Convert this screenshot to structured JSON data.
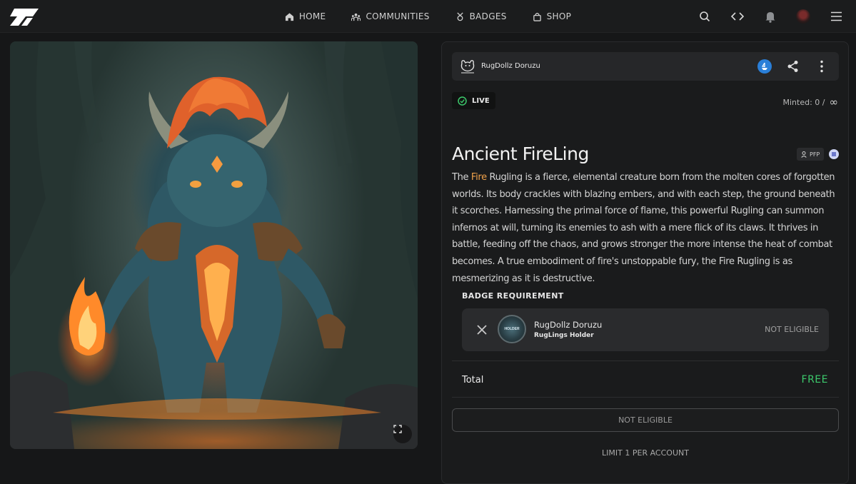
{
  "nav": {
    "logo_icon": "brand-logo-icon",
    "items": [
      {
        "label": "HOME",
        "icon": "home-icon"
      },
      {
        "label": "COMMUNITIES",
        "icon": "communities-icon"
      },
      {
        "label": "BADGES",
        "icon": "badge-icon"
      },
      {
        "label": "SHOP",
        "icon": "shop-bag-icon"
      }
    ],
    "right_icons": [
      "search-icon",
      "code-icon",
      "bell-icon",
      "avatar",
      "menu-icon"
    ]
  },
  "artwork": {
    "alt_icon": "artwork-image",
    "expand_icon": "expand-icon"
  },
  "collection": {
    "name": "RugDollz Doruzu",
    "chain_icon": "chain-icon",
    "share_icon": "share-icon",
    "more_icon": "more-vertical-icon"
  },
  "status": {
    "live_label": "LIVE",
    "minted_label": "Minted: 0 /",
    "minted_max_symbol": "∞"
  },
  "item": {
    "title": "Ancient FireLing",
    "tag": "PFP",
    "description_pre": "The ",
    "description_highlight": "Fire",
    "description_post": " Rugling is a fierce, elemental creature born from the molten cores of forgotten worlds. Its body crackles with blazing embers, and with each step, the ground beneath it scorches. Harnessing the primal force of flame, this powerful Rugling can summon infernos at will, turning its enemies to ash with a mere flick of its claws. It thrives in battle, feeding off the chaos, and grows stronger the more intense the heat of combat becomes. A true embodiment of fire's unstoppable fury, the Fire Rugling is as mesmerizing as it is destructive."
  },
  "requirement": {
    "label": "BADGE REQUIREMENT",
    "badge_name": "RugDollz Doruzu",
    "badge_sub": "RugLings Holder",
    "badge_text": "HOLDER",
    "status": "NOT ELIGIBLE"
  },
  "total": {
    "label": "Total",
    "value": "FREE",
    "value_color": "#3cc86b"
  },
  "cta": {
    "label": "NOT ELIGIBLE",
    "limit": "LIMIT 1 PER ACCOUNT"
  },
  "colors": {
    "accent": "#f0a24a",
    "live": "#3cc86b",
    "chain": "#2a7fd8"
  }
}
